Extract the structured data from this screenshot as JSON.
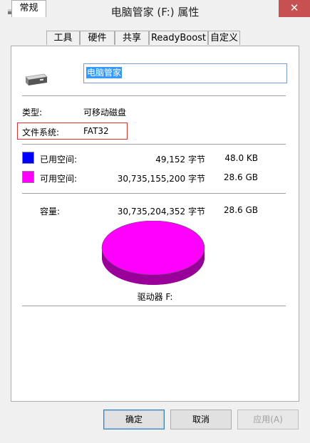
{
  "window": {
    "title": "电脑管家 (F:) 属性",
    "close_label": "✕"
  },
  "tabs": [
    {
      "label": "常规"
    },
    {
      "label": "工具"
    },
    {
      "label": "硬件"
    },
    {
      "label": "共享"
    },
    {
      "label": "ReadyBoost"
    },
    {
      "label": "自定义"
    }
  ],
  "drive": {
    "name_value": "电脑管家"
  },
  "info": {
    "type_label": "类型:",
    "type_value": "可移动磁盘",
    "fs_label": "文件系统:",
    "fs_value": "FAT32"
  },
  "space": {
    "used_label": "已用空间:",
    "used_bytes": "49,152 字节",
    "used_size": "48.0 KB",
    "used_color": "#0000ff",
    "free_label": "可用空间:",
    "free_bytes": "30,735,155,200 字节",
    "free_size": "28.6 GB",
    "free_color": "#ff00ff",
    "capacity_label": "容量:",
    "capacity_bytes": "30,735,204,352 字节",
    "capacity_size": "28.6 GB",
    "drive_label": "驱动器 F:"
  },
  "buttons": {
    "ok": "确定",
    "cancel": "取消",
    "apply": "应用(A)"
  }
}
